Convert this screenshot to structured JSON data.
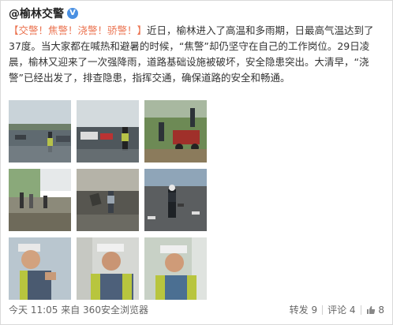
{
  "header": {
    "account": "@榆林交警",
    "verified_icon": "verified-v-icon"
  },
  "post": {
    "tag": "【交警！焦警！浇警！骄警！】",
    "text1": "近日，榆林进入了高温和多雨期，日最高气温达到了37度。当大家都在喊热和避暑的时候，“焦警”却仍坚守在自己的工作岗位。29日凌晨，榆林又迎来了一次强降雨，道路基础设施被破坏，安全隐患突出。大清早，“浇警”已经出发了，排查隐患，指挥交通，确保道路的安全和畅通。"
  },
  "photos": [
    {
      "name": "photo-rain-street-police"
    },
    {
      "name": "photo-traffic-rain-officer"
    },
    {
      "name": "photo-police-roadside-truck"
    },
    {
      "name": "photo-flooded-road-crowd"
    },
    {
      "name": "photo-officer-pushing-bin"
    },
    {
      "name": "photo-officer-flooded-crossing"
    },
    {
      "name": "photo-officer-closeup-sweat"
    },
    {
      "name": "photo-officer-cap-vest"
    },
    {
      "name": "photo-officer-smiling"
    }
  ],
  "footer": {
    "time": "今天 11:05",
    "source": "来自 360安全浏览器",
    "repost": "转发 9",
    "comment": "评论 4",
    "like": "8",
    "like_icon": "thumbs-up-icon"
  },
  "colors": {
    "highlight": "#eb7350",
    "vbadge": "#4a90e2"
  }
}
